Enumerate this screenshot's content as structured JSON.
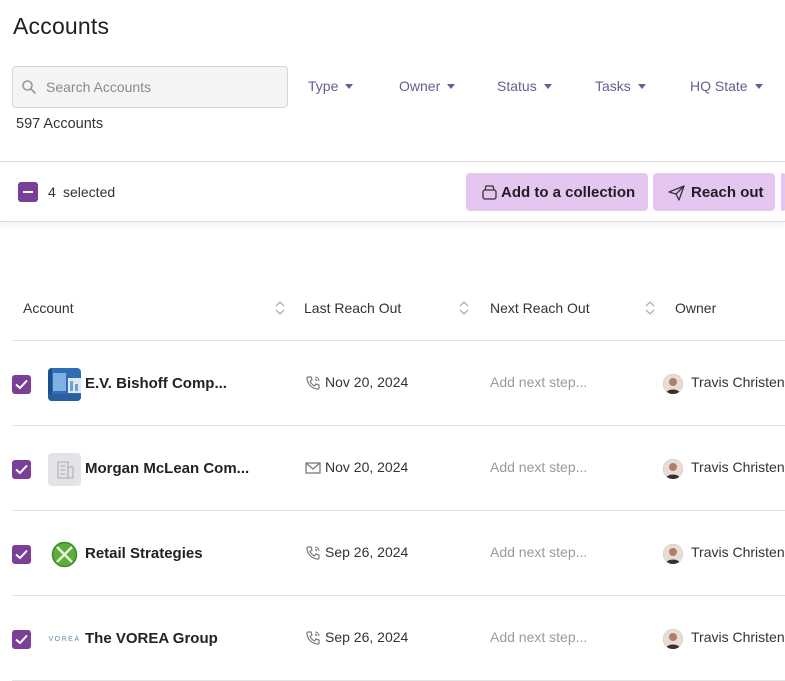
{
  "page": {
    "title": "Accounts"
  },
  "search": {
    "placeholder": "Search Accounts",
    "value": ""
  },
  "filters": [
    {
      "label": "Type"
    },
    {
      "label": "Owner"
    },
    {
      "label": "Status"
    },
    {
      "label": "Tasks"
    },
    {
      "label": "HQ State"
    }
  ],
  "summary": {
    "count_text": "597 Accounts"
  },
  "selection": {
    "count": "4",
    "label": "selected",
    "add_to_collection_label": "Add to a collection",
    "reach_out_label": "Reach out"
  },
  "table": {
    "columns": [
      {
        "label": "Account"
      },
      {
        "label": "Last Reach Out"
      },
      {
        "label": "Next Reach Out"
      },
      {
        "label": "Owner"
      }
    ],
    "rows": [
      {
        "name": "E.V. Bishoff Comp...",
        "logo_icon": "building-photo-logo",
        "reach_icon": "phone-icon",
        "last_reach_out": "Nov 20, 2024",
        "next_reach_out": "Add next step...",
        "owner": "Travis Christen",
        "selected": true
      },
      {
        "name": "Morgan McLean Com...",
        "logo_icon": "building-placeholder-icon",
        "reach_icon": "email-icon",
        "last_reach_out": "Nov 20, 2024",
        "next_reach_out": "Add next step...",
        "owner": "Travis Christen",
        "selected": true
      },
      {
        "name": "Retail Strategies",
        "logo_icon": "green-circle-x-logo",
        "reach_icon": "phone-icon",
        "last_reach_out": "Sep 26, 2024",
        "next_reach_out": "Add next step...",
        "owner": "Travis Christen",
        "selected": true
      },
      {
        "name": "The VOREA Group",
        "logo_icon": "vorea-wordmark-logo",
        "logo_text": "VOREA",
        "reach_icon": "phone-icon",
        "last_reach_out": "Sep 26, 2024",
        "next_reach_out": "Add next step...",
        "owner": "Travis Christen",
        "selected": true
      }
    ]
  },
  "colors": {
    "accent": "#7b3f98",
    "button_bg": "#e5c6f0",
    "filter_text": "#6b5b95",
    "muted": "#9a9a9a"
  }
}
